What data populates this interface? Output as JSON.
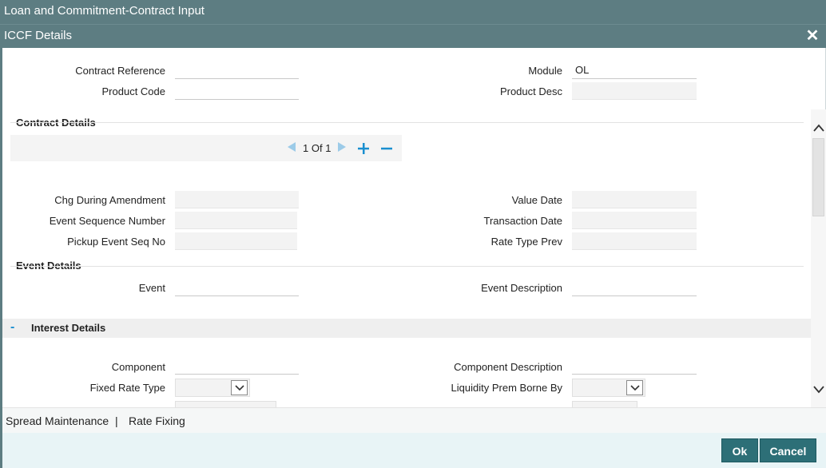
{
  "window": {
    "title": "Loan and Commitment-Contract Input"
  },
  "dialog": {
    "title": "ICCF Details",
    "close_symbol": "✕"
  },
  "header_fields": {
    "contract_reference": {
      "label": "Contract Reference",
      "value": ""
    },
    "product_code": {
      "label": "Product Code",
      "value": ""
    },
    "module": {
      "label": "Module",
      "value": "OL"
    },
    "product_desc": {
      "label": "Product Desc",
      "value": ""
    }
  },
  "contract_details": {
    "title": "Contract Details",
    "pager": {
      "current": "1",
      "of_label": "Of",
      "total": "1"
    },
    "fields": {
      "chg_during_amendment": {
        "label": "Chg During Amendment",
        "value": ""
      },
      "event_sequence_number": {
        "label": "Event Sequence Number",
        "value": ""
      },
      "pickup_event_seq_no": {
        "label": "Pickup Event Seq No",
        "value": ""
      },
      "value_date": {
        "label": "Value Date",
        "value": ""
      },
      "transaction_date": {
        "label": "Transaction Date",
        "value": ""
      },
      "rate_type_prev": {
        "label": "Rate Type Prev",
        "value": ""
      }
    }
  },
  "event_details": {
    "title": "Event Details",
    "event": {
      "label": "Event",
      "value": ""
    },
    "event_description": {
      "label": "Event Description",
      "value": ""
    }
  },
  "interest_details": {
    "title": "Interest Details",
    "toggle_symbol": "-",
    "component": {
      "label": "Component",
      "value": ""
    },
    "component_description": {
      "label": "Component Description",
      "value": ""
    },
    "fixed_rate_type": {
      "label": "Fixed Rate Type",
      "value": ""
    },
    "liquidity_prem_borne_by": {
      "label": "Liquidity Prem Borne By",
      "value": ""
    }
  },
  "links": {
    "spread_maintenance": "Spread Maintenance",
    "separator": "|",
    "rate_fixing": "Rate Fixing"
  },
  "buttons": {
    "ok": "Ok",
    "cancel": "Cancel"
  },
  "colors": {
    "titlebar": "#5d7d82",
    "accent": "#1a8fd0",
    "button": "#2d6f77",
    "footer": "#e8f4f6"
  }
}
